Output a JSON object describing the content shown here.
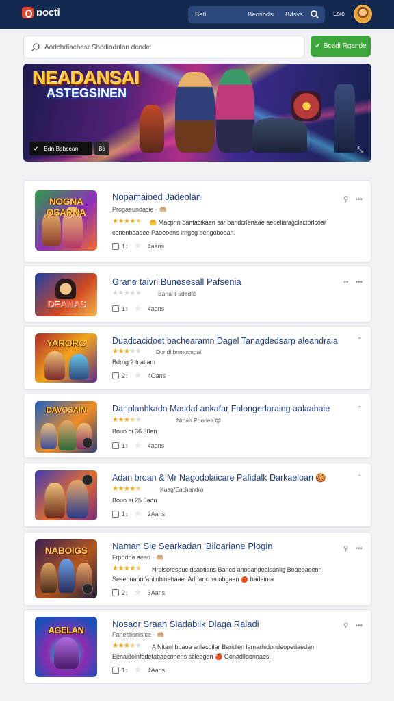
{
  "header": {
    "logo_text": "ɒocti",
    "nav": [
      "Beti",
      "Beosbdsi",
      "Bdsvs"
    ],
    "extra_link": "Lsic"
  },
  "search": {
    "placeholder": "Aodchdlachasr Shcdiodnlan dcode:",
    "button_label": "Bcadi Rgande",
    "button_icon": "check-icon"
  },
  "banner": {
    "title_line1": "NEADANSAI",
    "title_line2": "ASTEGSINEN",
    "button_label": "Bdn Bsbccan",
    "tag_label": "Bb",
    "colors": {
      "accent": "#ffc83a",
      "ray": "#ff50a0"
    }
  },
  "cards": [
    {
      "title": "Nopamaioed Jadeolan",
      "subtitle": "Progaeundacie  ·  🤲🏼",
      "rating": 4.5,
      "stars": "★★★★★",
      "rating_note": "",
      "desc_inline": "🤲 Macprin bantacikaen sar bandcrlenaae aedeliafagclactorlcoar",
      "desc_line2": "cenenbaaoee Paoeoens irngeg bengoboaan.",
      "count": "1↕",
      "size": "4aans",
      "thumb_title": "NOGNA\nOSARNA",
      "thumb_colors": [
        "#2d9c4a",
        "#8e2fb9",
        "#ef6a2a"
      ],
      "actions": [
        "pin-icon",
        "more-icon"
      ]
    },
    {
      "title": "Grane taivrl Bunesesall Pafsenia",
      "subtitle": "",
      "rating": 0,
      "stars": "★★★★★",
      "rating_note": "Banal Fudedlis",
      "desc_inline": "",
      "desc_line2": "",
      "count": "1↕",
      "size": "4aans",
      "thumb_title": "DEANAS",
      "thumb_colors": [
        "#1e3fa8",
        "#d04a21",
        "#f2b84b"
      ],
      "actions": [
        "dots-icon",
        "more-icon"
      ]
    },
    {
      "title": "Duadcacidoet bachearamn Dagel Tanagdedsarp aleandraia",
      "subtitle": "",
      "rating": 3,
      "stars": "★★★★★",
      "rating_note": "Dondl bnmocnoal",
      "desc_inline": "",
      "desc_line2": "Bdrog 2:tcatiam",
      "count": "2↕",
      "size": "4Oans",
      "thumb_title": "YARORG",
      "thumb_colors": [
        "#b02a2a",
        "#f2a51b",
        "#5a2d8e"
      ],
      "actions": [
        "chevron-up-icon"
      ]
    },
    {
      "title": "Danplanhkadn Masdaf ankafar Falongerlaraing aalaahaie",
      "subtitle": "",
      "rating": 3.5,
      "stars": "★★★★★",
      "rating_note": "Nman Poories  😊",
      "desc_inline": "",
      "desc_line2": "Bouo oi 36.30an",
      "count": "1↕",
      "size": "4aans",
      "thumb_title": "DAVOSAIN",
      "thumb_colors": [
        "#1b5fc4",
        "#f08d22",
        "#2c3e7a"
      ],
      "actions": [
        "chevron-up-icon"
      ]
    },
    {
      "title": "Adan broan & Mr Nagodolaicare Pafidalk Darkaeloan 🍪",
      "subtitle": "",
      "rating": 4.5,
      "stars": "★★★★★",
      "rating_note": "Kuag/Eachandra",
      "desc_inline": "",
      "desc_line2": "Bouo ai 25.5aon",
      "count": "1↕",
      "size": "2Aans",
      "thumb_title": "",
      "thumb_colors": [
        "#3f3ab8",
        "#e36b2b",
        "#7a2a7e"
      ],
      "actions": [
        "chevron-up-icon"
      ]
    },
    {
      "title": "Naman Sie Searkadan 'Blioariane Plogin",
      "subtitle": "Frpodoa aean  ·  🤲🏼",
      "rating": 4.5,
      "stars": "★★★★★",
      "rating_note": "",
      "desc_inline": "Nrelsoreseuc dsaotians Bancd anodandealsanlig Boaeoaoenn",
      "desc_line2": "Sesebnaoni'antinbinebaae. Adbanc tecobgaen 🍎 badaima",
      "count": "2↕",
      "size": "3Aans",
      "thumb_title": "NABOIGS",
      "thumb_colors": [
        "#3a1d4f",
        "#b2571f",
        "#22213b"
      ],
      "actions": [
        "pin-icon",
        "more-icon"
      ]
    },
    {
      "title": "Nosaor Sraan Siadabilk Dlaga Raiadi",
      "subtitle": "Fanecllonisice  ·  🤲🏼",
      "rating": 4,
      "stars": "★★★★★",
      "rating_note": "",
      "desc_inline": "A Nitanl buaoe anlacdilar Baridlen lamarhidondeopedaedan",
      "desc_line2": "Eenaidolnfedetabaeconens scleogen 🍎 Gonadlloonnaes.",
      "count": "1↕",
      "size": "4Aans",
      "thumb_title": "AGELAN",
      "thumb_colors": [
        "#1f4fb8",
        "#8e2ab0",
        "#1bb4c8"
      ],
      "actions": [
        "pin-icon",
        "more-icon"
      ]
    }
  ]
}
